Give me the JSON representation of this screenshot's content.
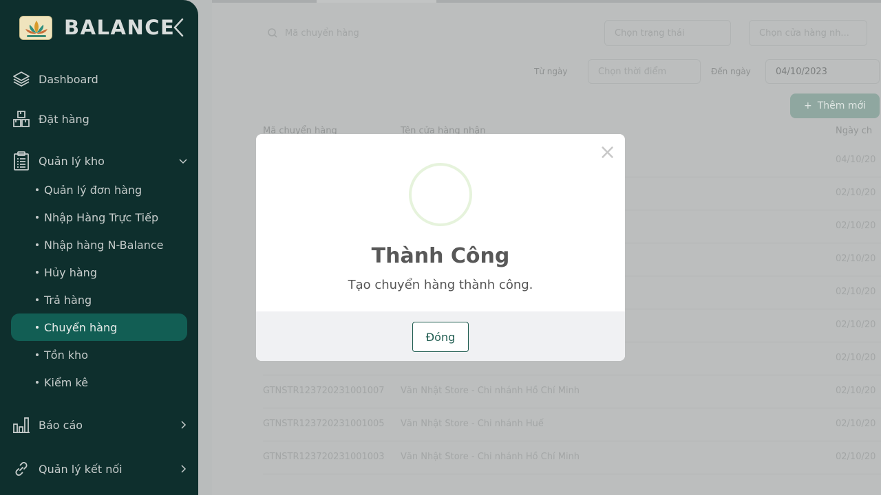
{
  "app": {
    "name": "BALANCE"
  },
  "sidebar": {
    "dashboard": "Dashboard",
    "order": "Đặt hàng",
    "warehouse": "Quản lý kho",
    "sub_items": [
      "Quản lý đơn hàng",
      "Nhập Hàng Trực Tiếp",
      "Nhập hàng N-Balance",
      "Hủy hàng",
      "Trả hàng",
      "Chuyển hàng",
      "Tồn kho",
      "Kiểm kê"
    ],
    "active_sub": "Chuyển hàng",
    "report": "Báo cáo",
    "connection": "Quản lý kết nối"
  },
  "filters": {
    "search_placeholder": "Mã chuyển hàng",
    "status_placeholder": "Chọn trạng thái",
    "store_placeholder": "Chọn cửa hàng nh...",
    "from_label": "Từ ngày",
    "from_placeholder": "Chọn thời điểm",
    "to_label": "Đến ngày",
    "to_value": "04/10/2023",
    "add_button": "Thêm mới"
  },
  "table": {
    "headers": [
      "Mã chuyển hàng",
      "Tên cửa hàng nhận",
      "Ngày ch"
    ],
    "rows": [
      {
        "code": "",
        "store": "",
        "date": "04/10/20"
      },
      {
        "code": "",
        "store": "",
        "date": "02/10/20"
      },
      {
        "code": "",
        "store": "",
        "date": "02/10/20"
      },
      {
        "code": "",
        "store": "",
        "date": "02/10/20"
      },
      {
        "code": "",
        "store": "",
        "date": "02/10/20"
      },
      {
        "code": "",
        "store": "",
        "date": "02/10/20"
      },
      {
        "code": "",
        "store": "",
        "date": "02/10/20"
      },
      {
        "code": "GTNSTR123720231001007",
        "store": "Văn Nhật Store - Chi nhánh Hồ Chí Minh",
        "date": "02/10/20"
      },
      {
        "code": "GTNSTR123720231001005",
        "store": "Văn Nhật Store - Chi nhánh Huế",
        "date": "02/10/20"
      },
      {
        "code": "GTNSTR123720231001003",
        "store": "Văn Nhật Store - Chi nhánh Hồ Chí Minh",
        "date": "02/10/20"
      }
    ]
  },
  "modal": {
    "title": "Thành Công",
    "message": "Tạo chuyển hàng thành công.",
    "button": "Đóng",
    "close_symbol": "×"
  },
  "colors": {
    "sidebar_bg": "#0e2f2d",
    "active_item": "#125e54",
    "brand_text": "#d9dddc",
    "primary_button_border": "#1f5c50",
    "success_ring": "#e6f3dc"
  }
}
